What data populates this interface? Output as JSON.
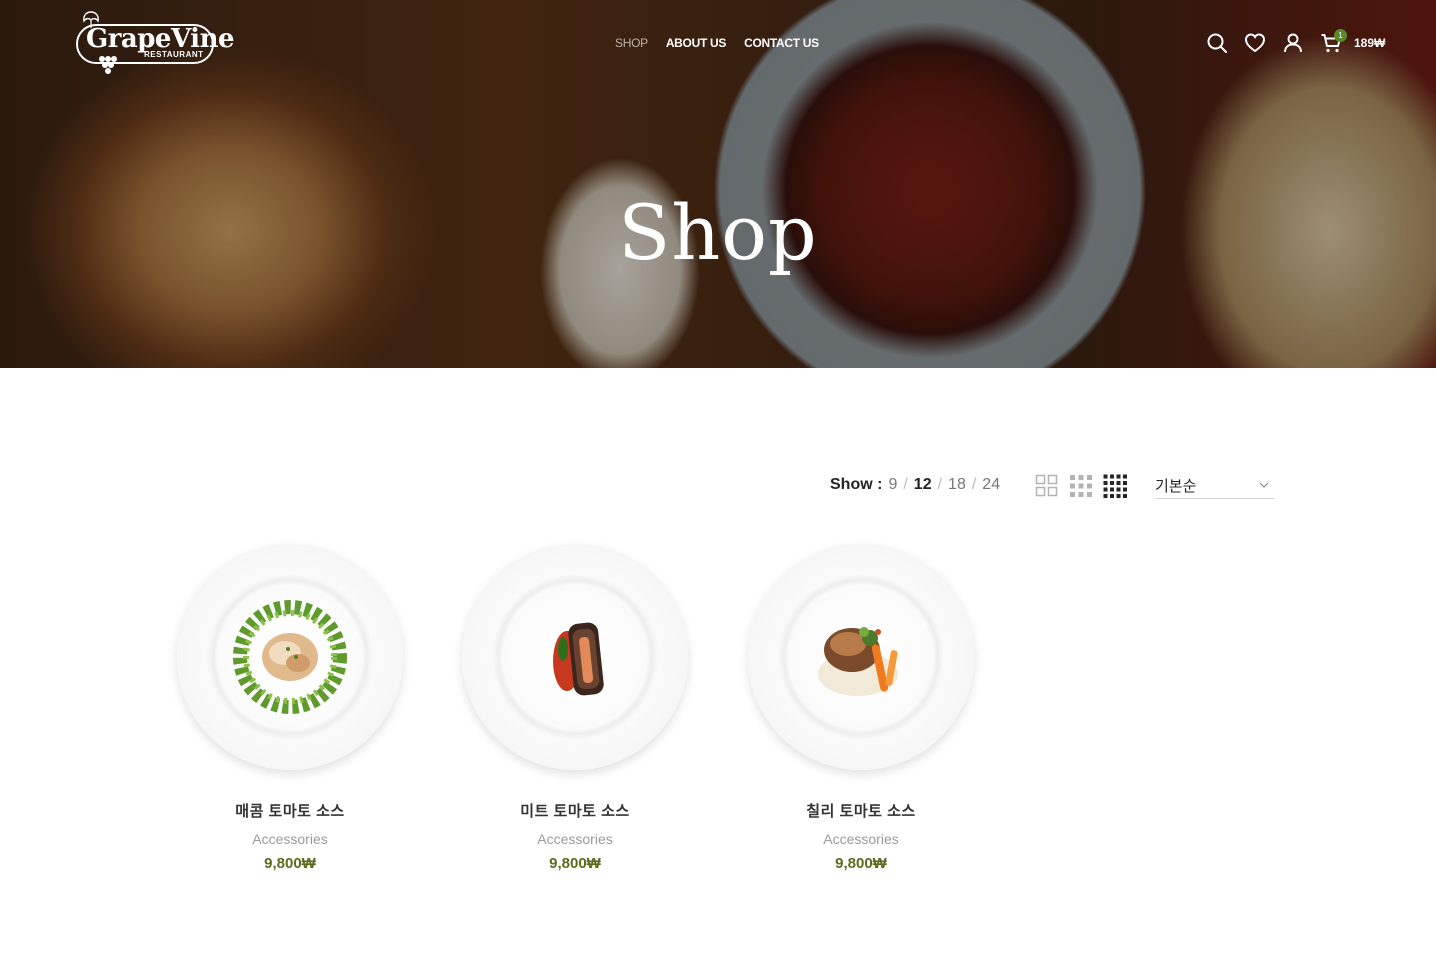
{
  "brand": {
    "name": "GrapeVine",
    "tagline": "RESTAURANT"
  },
  "nav": {
    "items": [
      {
        "label": "SHOP",
        "active": true
      },
      {
        "label": "ABOUT US",
        "active": false
      },
      {
        "label": "CONTACT US",
        "active": false
      }
    ]
  },
  "header_icons": {
    "search": "search-icon",
    "wishlist": "heart-icon",
    "account": "user-icon",
    "cart": "cart-icon"
  },
  "cart": {
    "count": "1",
    "total": "189₩"
  },
  "hero": {
    "title": "Shop"
  },
  "toolbar": {
    "show_label": "Show :",
    "per_page": [
      "9",
      "12",
      "18",
      "24"
    ],
    "per_page_selected": "12",
    "sort_label": "기본순"
  },
  "products": [
    {
      "name": "매콤 토마토 소스",
      "category": "Accessories",
      "price": "9,800₩"
    },
    {
      "name": "미트 토마토 소스",
      "category": "Accessories",
      "price": "9,800₩"
    },
    {
      "name": "칠리 토마토 소스",
      "category": "Accessories",
      "price": "9,800₩"
    }
  ],
  "colors": {
    "price": "#5c6b1d",
    "badge": "#5b8a2b",
    "text": "#242424"
  }
}
